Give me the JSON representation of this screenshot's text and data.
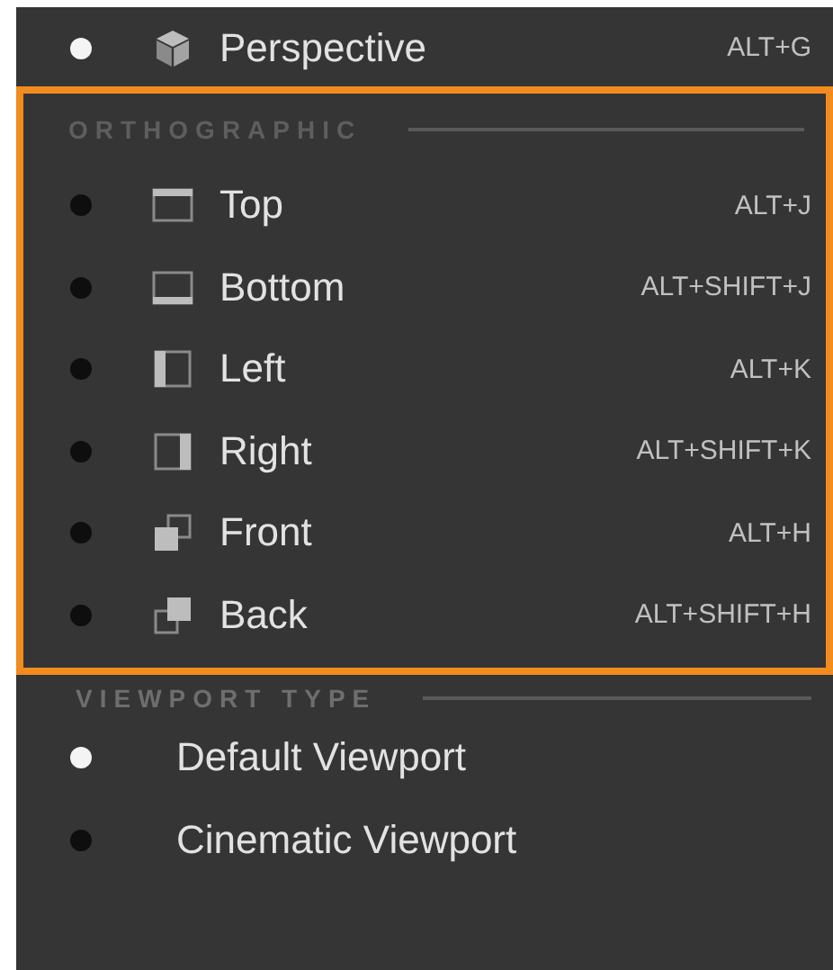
{
  "top_items": [
    {
      "label": "Perspective",
      "shortcut": "ALT+G",
      "selected": true,
      "kind": "cube"
    }
  ],
  "orthographic": {
    "heading": "ORTHOGRAPHIC",
    "highlighted": true,
    "items": [
      {
        "label": "Top",
        "shortcut": "ALT+J",
        "selected": false,
        "kind": "top"
      },
      {
        "label": "Bottom",
        "shortcut": "ALT+SHIFT+J",
        "selected": false,
        "kind": "bottom"
      },
      {
        "label": "Left",
        "shortcut": "ALT+K",
        "selected": false,
        "kind": "left"
      },
      {
        "label": "Right",
        "shortcut": "ALT+SHIFT+K",
        "selected": false,
        "kind": "right"
      },
      {
        "label": "Front",
        "shortcut": "ALT+H",
        "selected": false,
        "kind": "front"
      },
      {
        "label": "Back",
        "shortcut": "ALT+SHIFT+H",
        "selected": false,
        "kind": "back"
      }
    ]
  },
  "viewport_type": {
    "heading": "VIEWPORT TYPE",
    "items": [
      {
        "label": "Default Viewport",
        "selected": true
      },
      {
        "label": "Cinematic Viewport",
        "selected": false
      }
    ]
  }
}
